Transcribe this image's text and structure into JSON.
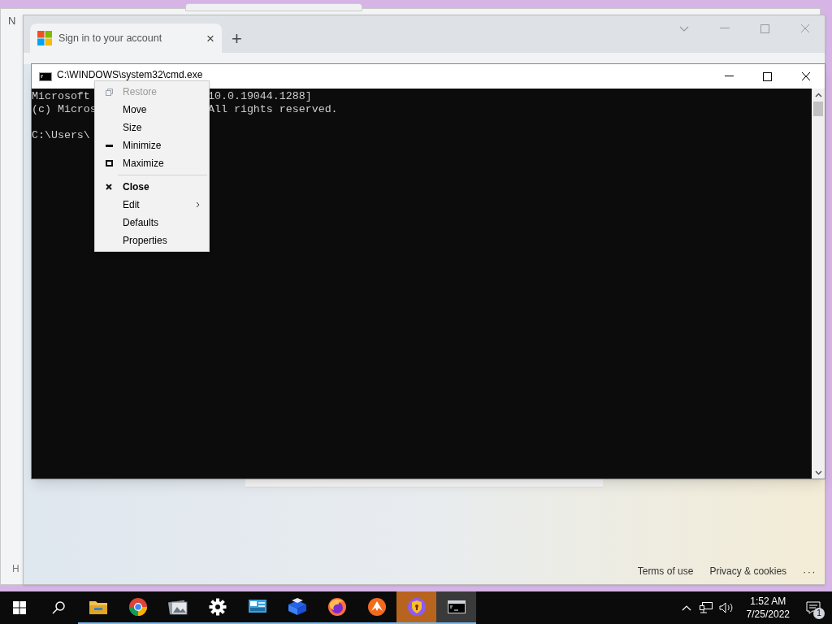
{
  "background_window": {
    "title_fragment": "N",
    "footer_fragment": "H"
  },
  "browser": {
    "tab": {
      "title": "Sign in to your account",
      "close": "×",
      "selected": true
    },
    "new_tab": "+",
    "footer_links": [
      "Terms of use",
      "Privacy & cookies"
    ],
    "more": "···"
  },
  "console_window": {
    "title": "C:\\WINDOWS\\system32\\cmd.exe",
    "blocks": [
      [
        {
          "left": "Microsoft",
          "right": "10.0.19044.1288]"
        },
        {
          "left": "(c) Micros",
          "right": "All rights reserved."
        }
      ],
      [
        {
          "left": "C:\\Users\\"
        }
      ]
    ]
  },
  "context_menu": [
    {
      "kind": "item",
      "label": "Restore",
      "disabled": true,
      "bold": false,
      "submenu": false
    },
    {
      "kind": "item",
      "label": "Move",
      "disabled": false,
      "bold": false,
      "submenu": false
    },
    {
      "kind": "item",
      "label": "Size",
      "disabled": false,
      "bold": false,
      "submenu": false
    },
    {
      "kind": "item",
      "label": "Minimize",
      "disabled": false,
      "bold": false,
      "submenu": false
    },
    {
      "kind": "item",
      "label": "Maximize",
      "disabled": false,
      "bold": false,
      "submenu": false
    },
    {
      "kind": "separator"
    },
    {
      "kind": "item",
      "label": "Close",
      "disabled": false,
      "bold": true,
      "submenu": false
    },
    {
      "kind": "item",
      "label": "Edit",
      "disabled": false,
      "bold": false,
      "submenu": true
    },
    {
      "kind": "item",
      "label": "Defaults",
      "disabled": false,
      "bold": false,
      "submenu": false
    },
    {
      "kind": "item",
      "label": "Properties",
      "disabled": false,
      "bold": false,
      "submenu": false
    }
  ],
  "taskbar": {
    "apps": [
      {
        "kind": "folder",
        "selected": false
      },
      {
        "kind": "chrome",
        "selected": false
      },
      {
        "kind": "photos",
        "selected": false
      },
      {
        "kind": "gear",
        "selected": false
      },
      {
        "kind": "monitor",
        "selected": false
      },
      {
        "kind": "box",
        "selected": false
      },
      {
        "kind": "firefox",
        "selected": false
      },
      {
        "kind": "flame",
        "selected": false
      },
      {
        "kind": "shield",
        "selected": true
      },
      {
        "kind": "console",
        "selected": true
      }
    ],
    "time": "1:52 AM",
    "date": "7/25/2022",
    "notifications": "1"
  }
}
